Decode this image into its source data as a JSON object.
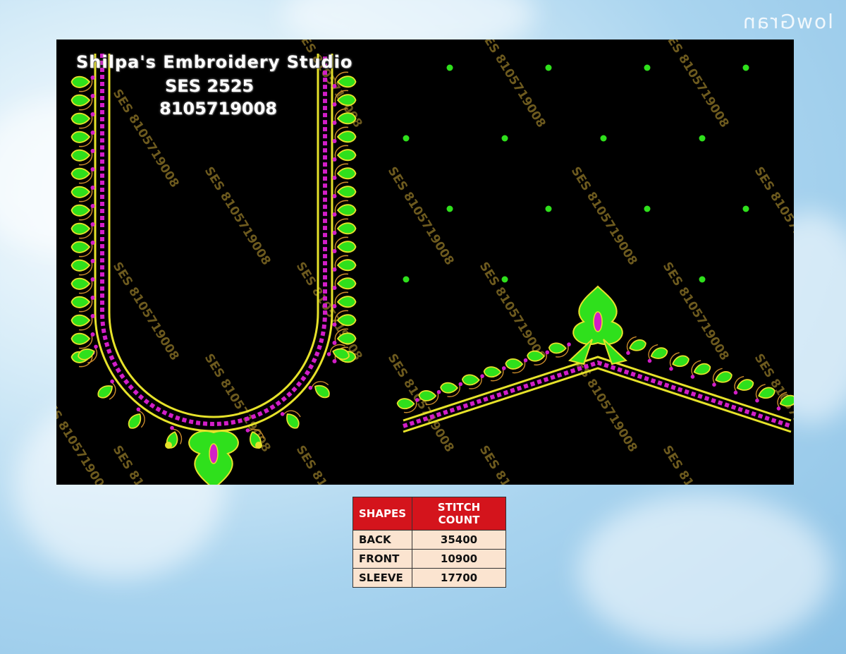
{
  "studio": {
    "name": "Shilpa's Embroidery Studio",
    "design_code": "SES 2525",
    "phone": "8105719008"
  },
  "watermark": "SES 8105719008",
  "corner_mark": "lowGran",
  "colors": {
    "panel_background": "#000000",
    "leaf_green": "#2fe01c",
    "border_gold": "#e6e22a",
    "accent_magenta": "#d21ec8",
    "table_header": "#d4141c",
    "table_cell": "#fbe4d0"
  },
  "table": {
    "headers": [
      "SHAPES",
      "STITCH COUNT"
    ],
    "rows": [
      {
        "shape": "BACK",
        "count": "35400"
      },
      {
        "shape": "FRONT",
        "count": "10900"
      },
      {
        "shape": "SLEEVE",
        "count": "17700"
      }
    ]
  }
}
